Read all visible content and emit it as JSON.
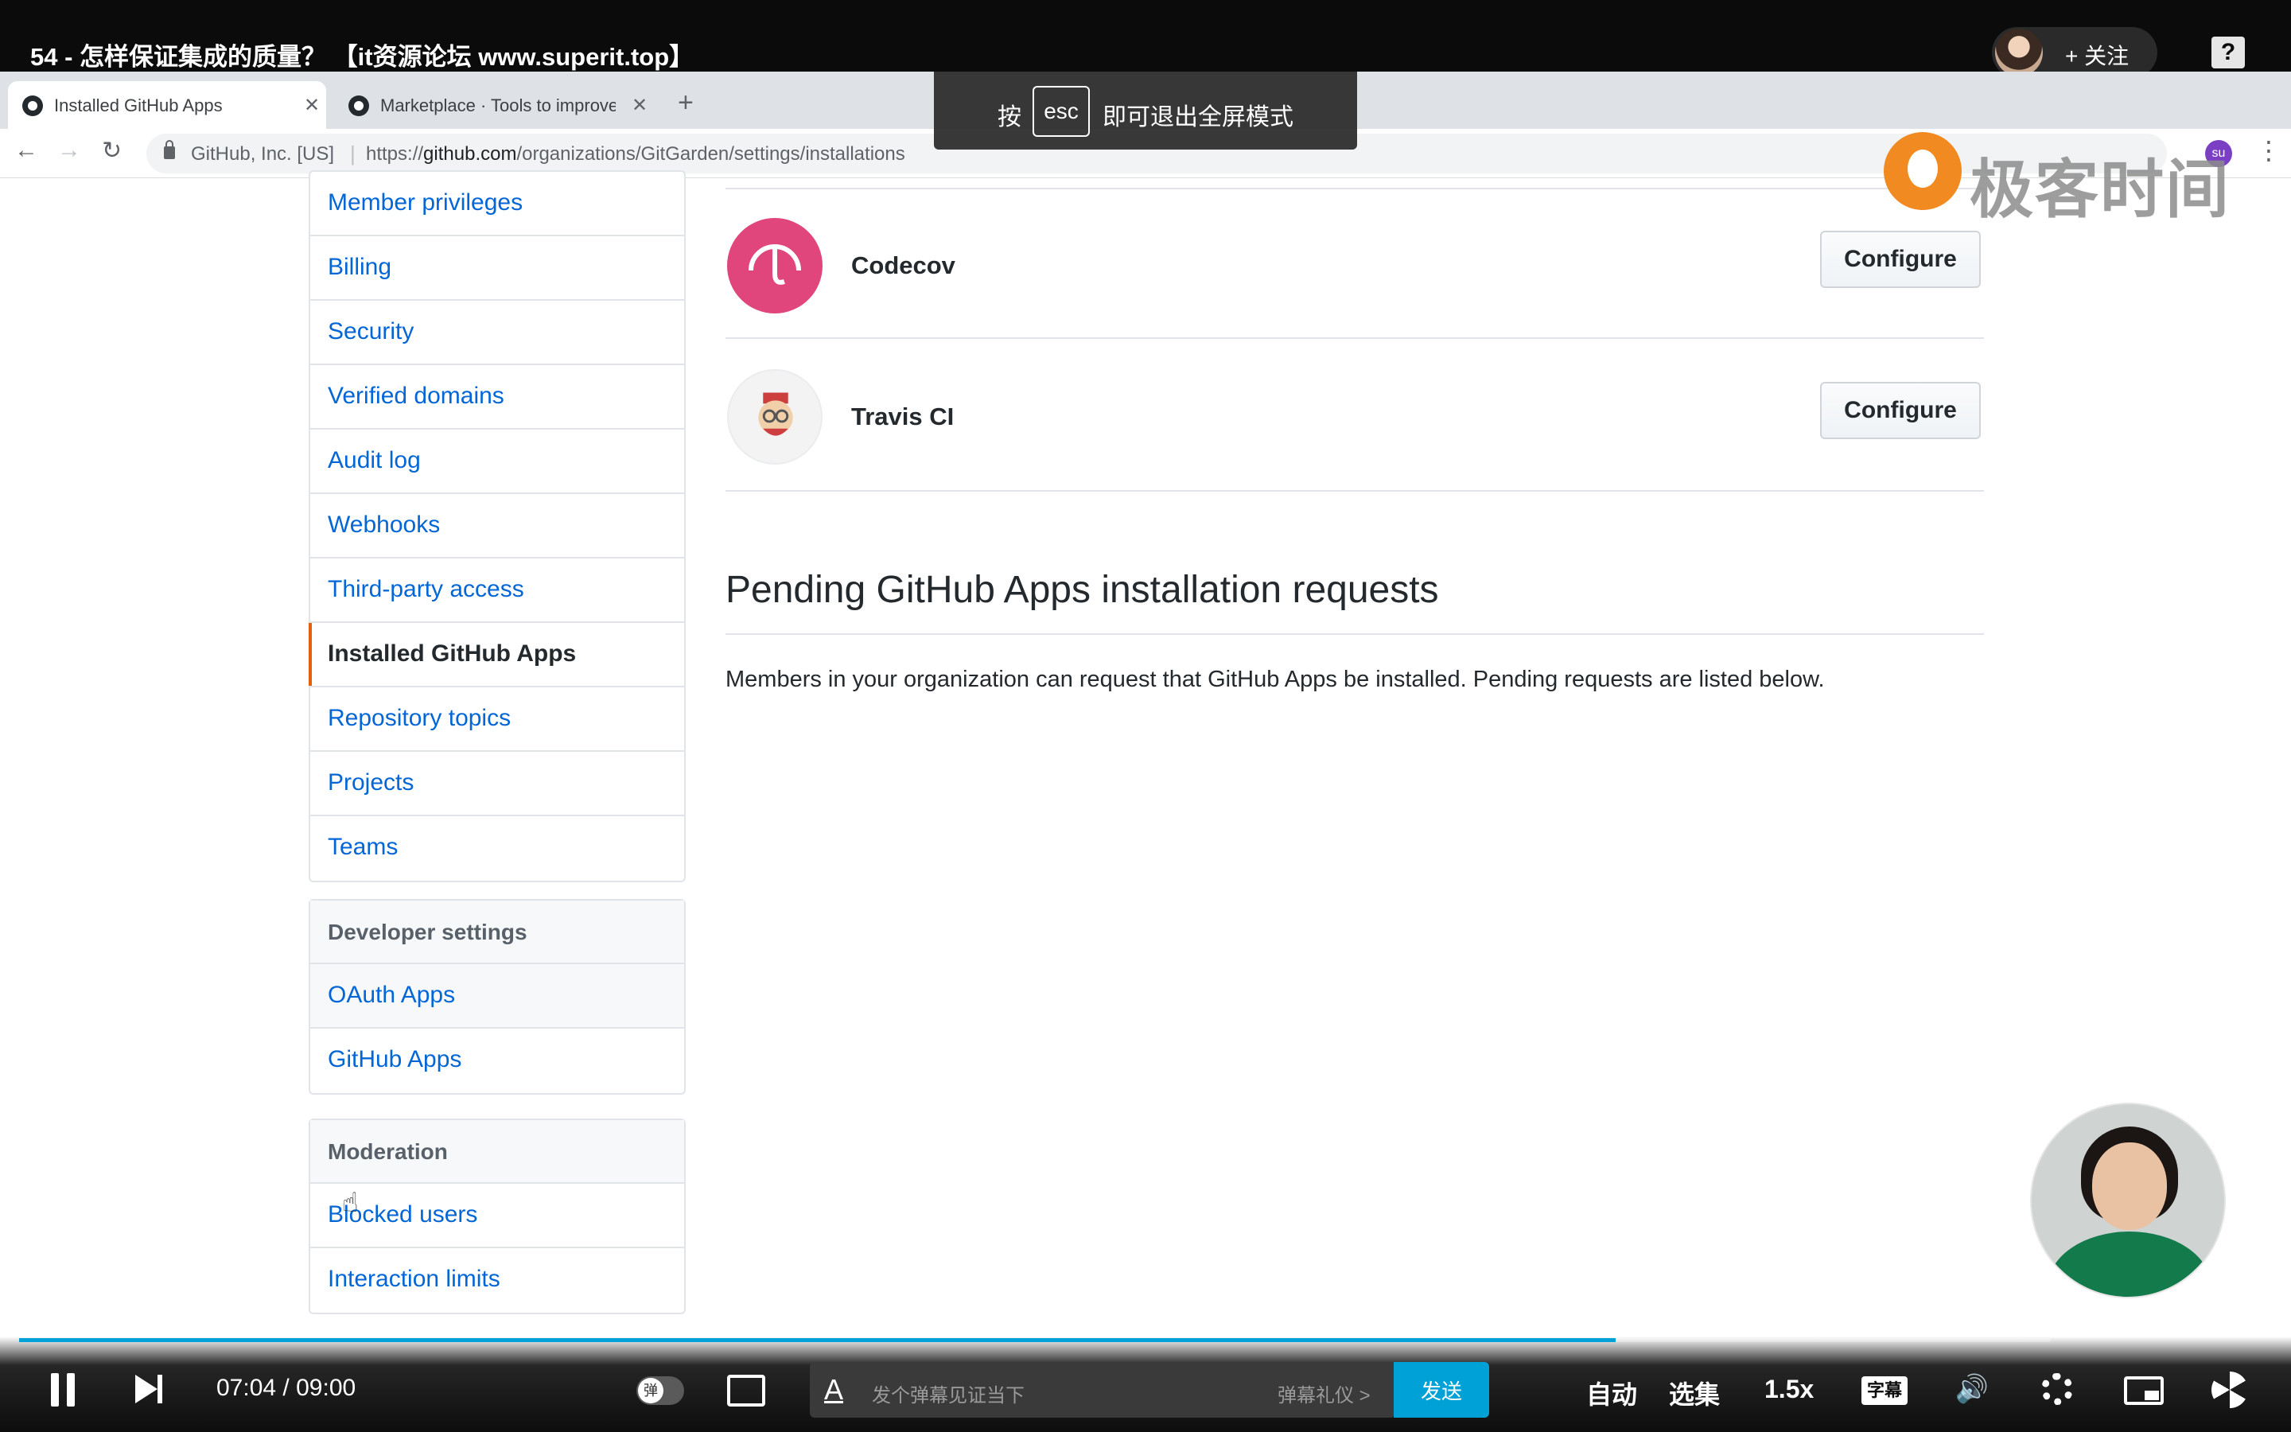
{
  "video": {
    "title": "54 - 怎样保证集成的质量？ 【it资源论坛 www.superit.top】",
    "follow_label": "+ 关注",
    "help_label": "?"
  },
  "browser": {
    "tabs": [
      {
        "title": "Installed GitHub Apps",
        "active": true
      },
      {
        "title": "Marketplace · Tools to improve",
        "active": false
      }
    ],
    "new_tab_label": "+",
    "nav": {
      "back": "←",
      "forward": "→",
      "reload": "↻"
    },
    "site_identity": "GitHub, Inc. [US]",
    "url_prefix": "https://",
    "url_host": "github.com",
    "url_path": "/organizations/GitGarden/settings/installations",
    "profile_initials": "su",
    "menu_label": "⋮"
  },
  "esc_overlay": {
    "pre": "按",
    "key": "esc",
    "post": "即可退出全屏模式"
  },
  "watermark": {
    "text": "极客时间"
  },
  "sidebar": {
    "main_items": [
      {
        "label": "Member privileges"
      },
      {
        "label": "Billing"
      },
      {
        "label": "Security"
      },
      {
        "label": "Verified domains"
      },
      {
        "label": "Audit log"
      },
      {
        "label": "Webhooks"
      },
      {
        "label": "Third-party access"
      },
      {
        "label": "Installed GitHub Apps",
        "selected": true
      },
      {
        "label": "Repository topics"
      },
      {
        "label": "Projects"
      },
      {
        "label": "Teams"
      }
    ],
    "developer": {
      "header": "Developer settings",
      "items": [
        {
          "label": "OAuth Apps"
        },
        {
          "label": "GitHub Apps"
        }
      ]
    },
    "moderation": {
      "header": "Moderation",
      "items": [
        {
          "label": "Blocked users"
        },
        {
          "label": "Interaction limits"
        }
      ]
    }
  },
  "apps": [
    {
      "name": "Codecov",
      "button_label": "Configure"
    },
    {
      "name": "Travis CI",
      "button_label": "Configure"
    }
  ],
  "pending": {
    "heading": "Pending GitHub Apps installation requests",
    "description": "Members in your organization can request that GitHub Apps be installed. Pending requests are listed below."
  },
  "player": {
    "current_time": "07:04",
    "separator": "/",
    "total_time": "09:00",
    "progress_fraction": 0.786,
    "danmaku_placeholder": "发个弹幕见证当下",
    "danmaku_etiquette": "弹幕礼仪 >",
    "send_label": "发送",
    "auto_label": "自动",
    "episodes_label": "选集",
    "speed_label": "1.5x",
    "subtitle_label": "字幕",
    "font_label": "A"
  },
  "colors": {
    "link": "#0366d6",
    "selected_marker": "#e36209",
    "codecov_brand": "#e0457b",
    "player_accent": "#00a1d6"
  }
}
